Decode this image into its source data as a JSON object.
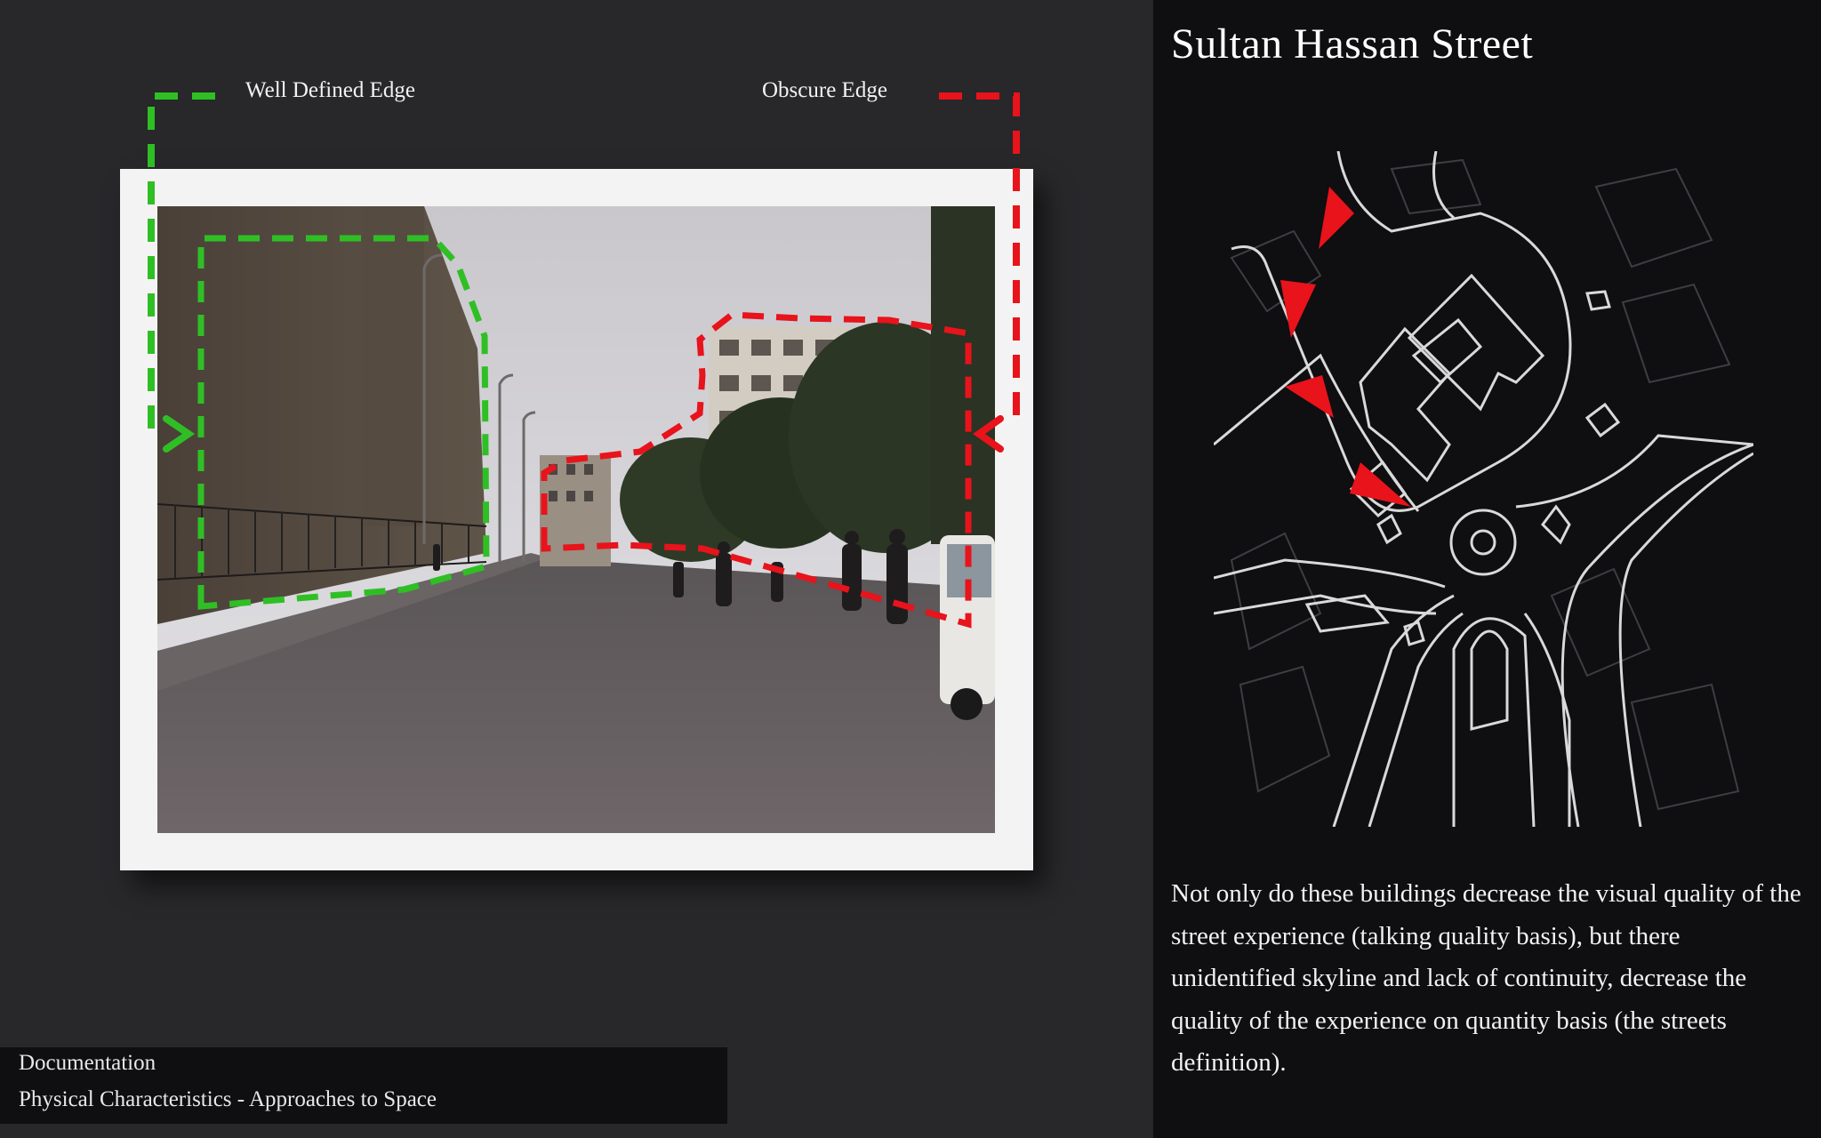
{
  "legend": {
    "well_defined_label": "Well Defined Edge",
    "obscure_label": "Obscure Edge",
    "well_defined_color": "#2fbf25",
    "obscure_color": "#e8131b"
  },
  "page": {
    "title": "Sultan Hassan Street",
    "description": "Not only do these buildings decrease the visual quality of the street experience (talking quality basis), but there unidentified skyline and lack of continuity, decrease the quality of the experience on quantity basis (the streets definition)."
  },
  "footer": {
    "section": "Documentation",
    "subsection": "Physical Characteristics - Approaches to Space"
  },
  "colors": {
    "left_background": "#28272a",
    "right_background": "#0f0e10",
    "map_lines": "#d9d9d9"
  }
}
